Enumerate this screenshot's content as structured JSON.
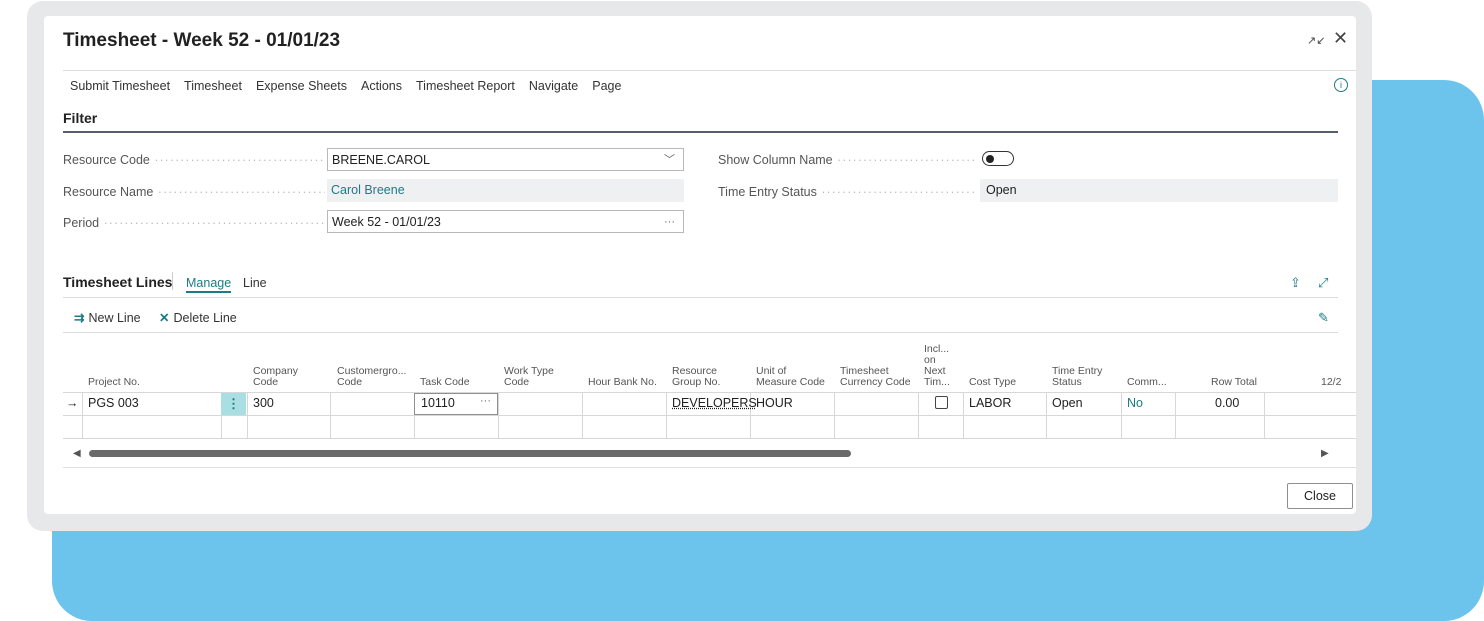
{
  "window": {
    "title": "Timesheet - Week 52 - 01/01/23",
    "collapse_glyph": "↗↙",
    "close_glyph": "✕"
  },
  "action_bar": {
    "items": [
      "Submit Timesheet",
      "Timesheet",
      "Expense Sheets",
      "Actions",
      "Timesheet Report",
      "Navigate",
      "Page"
    ],
    "info_glyph": "i"
  },
  "filter": {
    "heading": "Filter",
    "resource_code": {
      "label": "Resource Code",
      "value": "BREENE.CAROL",
      "suffix": "﹀"
    },
    "resource_name": {
      "label": "Resource Name",
      "value": "Carol Breene"
    },
    "period": {
      "label": "Period",
      "value": "Week 52 - 01/01/23",
      "suffix": "···"
    },
    "show_column_name": {
      "label": "Show Column Name"
    },
    "time_entry_status": {
      "label": "Time Entry Status",
      "value": "Open"
    }
  },
  "lines": {
    "heading": "Timesheet Lines",
    "tabs": [
      "Manage",
      "Line"
    ],
    "new_line": "New Line",
    "delete_line": "Delete Line",
    "share_glyph": "⇪",
    "expand_glyph": "⤢",
    "personalize_glyph": "✎",
    "new_line_glyph": "⇉",
    "delete_line_glyph": "✕",
    "columns": [
      [
        "Project No."
      ],
      [
        "Company",
        "Code"
      ],
      [
        "Customergro...",
        "Code"
      ],
      [
        "Task Code"
      ],
      [
        "Work Type",
        "Code"
      ],
      [
        "Hour Bank No."
      ],
      [
        "Resource",
        "Group No."
      ],
      [
        "Unit of",
        "Measure Code"
      ],
      [
        "Timesheet",
        "Currency Code"
      ],
      [
        "Incl...",
        "on",
        "Next",
        "Tim..."
      ],
      [
        "Cost Type"
      ],
      [
        "Time Entry",
        "Status"
      ],
      [
        "Comm..."
      ],
      [
        "Row Total"
      ],
      [
        "12/2"
      ]
    ],
    "row": {
      "arrow": "→",
      "project_no": "PGS 003",
      "row_menu": "⋮",
      "company_code": "300",
      "task_code": "10110",
      "task_code_suffix": "···",
      "resource_group_no": "DEVELOPERS",
      "unit_of_measure": "HOUR",
      "cost_type": "LABOR",
      "time_entry_status": "Open",
      "comments": "No",
      "row_total": "0.00"
    },
    "scroll_left": "◀",
    "scroll_right": "▶",
    "scroll_position": 0.63
  },
  "footer": {
    "close_label": "Close"
  },
  "colors": {
    "accent": "#1d7c83",
    "background_blue": "#6cc4ec",
    "frame_gray": "#e7e8ea"
  }
}
